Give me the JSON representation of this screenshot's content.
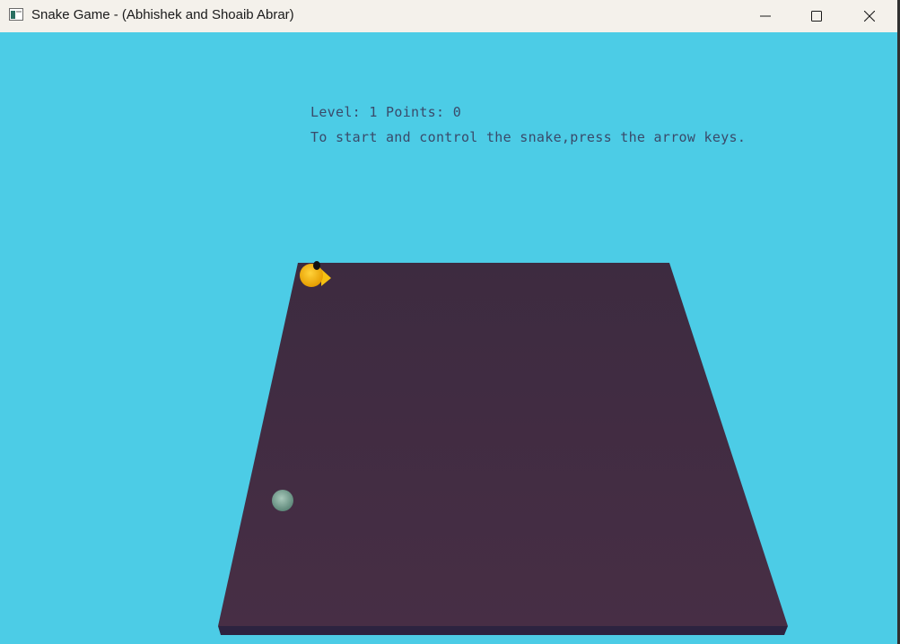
{
  "window": {
    "title": "Snake Game - (Abhishek and Shoaib Abrar)",
    "icons": {
      "app": "app-window-icon",
      "minimize": "minimize-icon",
      "maximize": "maximize-icon",
      "close": "close-icon"
    }
  },
  "hud": {
    "level_label": "Level:",
    "level_value": "1",
    "points_label": "Points:",
    "points_value": "0",
    "instructions": "To start and control the snake,press the arrow keys."
  },
  "colors": {
    "background": "#4ccce6",
    "board": "#412c42",
    "snake": "#f5b90a",
    "food": "#7fa496",
    "hud_text": "#3a4a6a"
  }
}
